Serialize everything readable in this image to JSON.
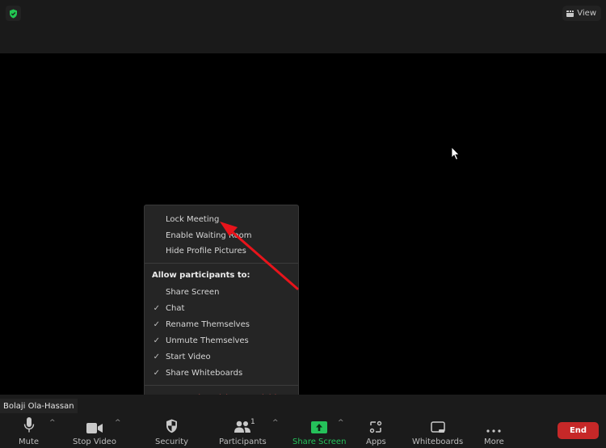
{
  "top_bar": {
    "security_icon": "shield-check-icon",
    "view_button": {
      "label": "View",
      "icon": "grid-view-icon"
    }
  },
  "security_menu": {
    "items_top": [
      {
        "label": "Lock Meeting",
        "checked": false
      },
      {
        "label": "Enable Waiting Room",
        "checked": false
      },
      {
        "label": "Hide Profile Pictures",
        "checked": false
      }
    ],
    "section_heading": "Allow participants to:",
    "permissions": [
      {
        "label": "Share Screen",
        "checked": false,
        "check": ""
      },
      {
        "label": "Chat",
        "checked": true,
        "check": "✓"
      },
      {
        "label": "Rename Themselves",
        "checked": true,
        "check": "✓"
      },
      {
        "label": "Unmute Themselves",
        "checked": true,
        "check": "✓"
      },
      {
        "label": "Start Video",
        "checked": true,
        "check": "✓"
      },
      {
        "label": "Share Whiteboards",
        "checked": true,
        "check": "✓"
      }
    ],
    "danger_item": {
      "label": "Suspend Participant Activities"
    }
  },
  "annotation": {
    "arrow_color": "#e8141b",
    "points_to": "Lock Meeting"
  },
  "participant_name": "Bolaji Ola-Hassan",
  "toolbar": {
    "mute": {
      "label": "Mute",
      "icon": "microphone-icon"
    },
    "stop_video": {
      "label": "Stop Video",
      "icon": "video-camera-icon"
    },
    "security": {
      "label": "Security",
      "icon": "shield-icon"
    },
    "participants": {
      "label": "Participants",
      "icon": "people-icon",
      "count": "1"
    },
    "share_screen": {
      "label": "Share Screen",
      "icon": "share-arrow-icon",
      "color": "#25c15a"
    },
    "apps": {
      "label": "Apps",
      "icon": "apps-icon"
    },
    "whiteboards": {
      "label": "Whiteboards",
      "icon": "whiteboard-icon"
    },
    "more": {
      "label": "More",
      "icon": "ellipsis-icon"
    },
    "end": {
      "label": "End",
      "color": "#c62828"
    },
    "caret": "^"
  }
}
